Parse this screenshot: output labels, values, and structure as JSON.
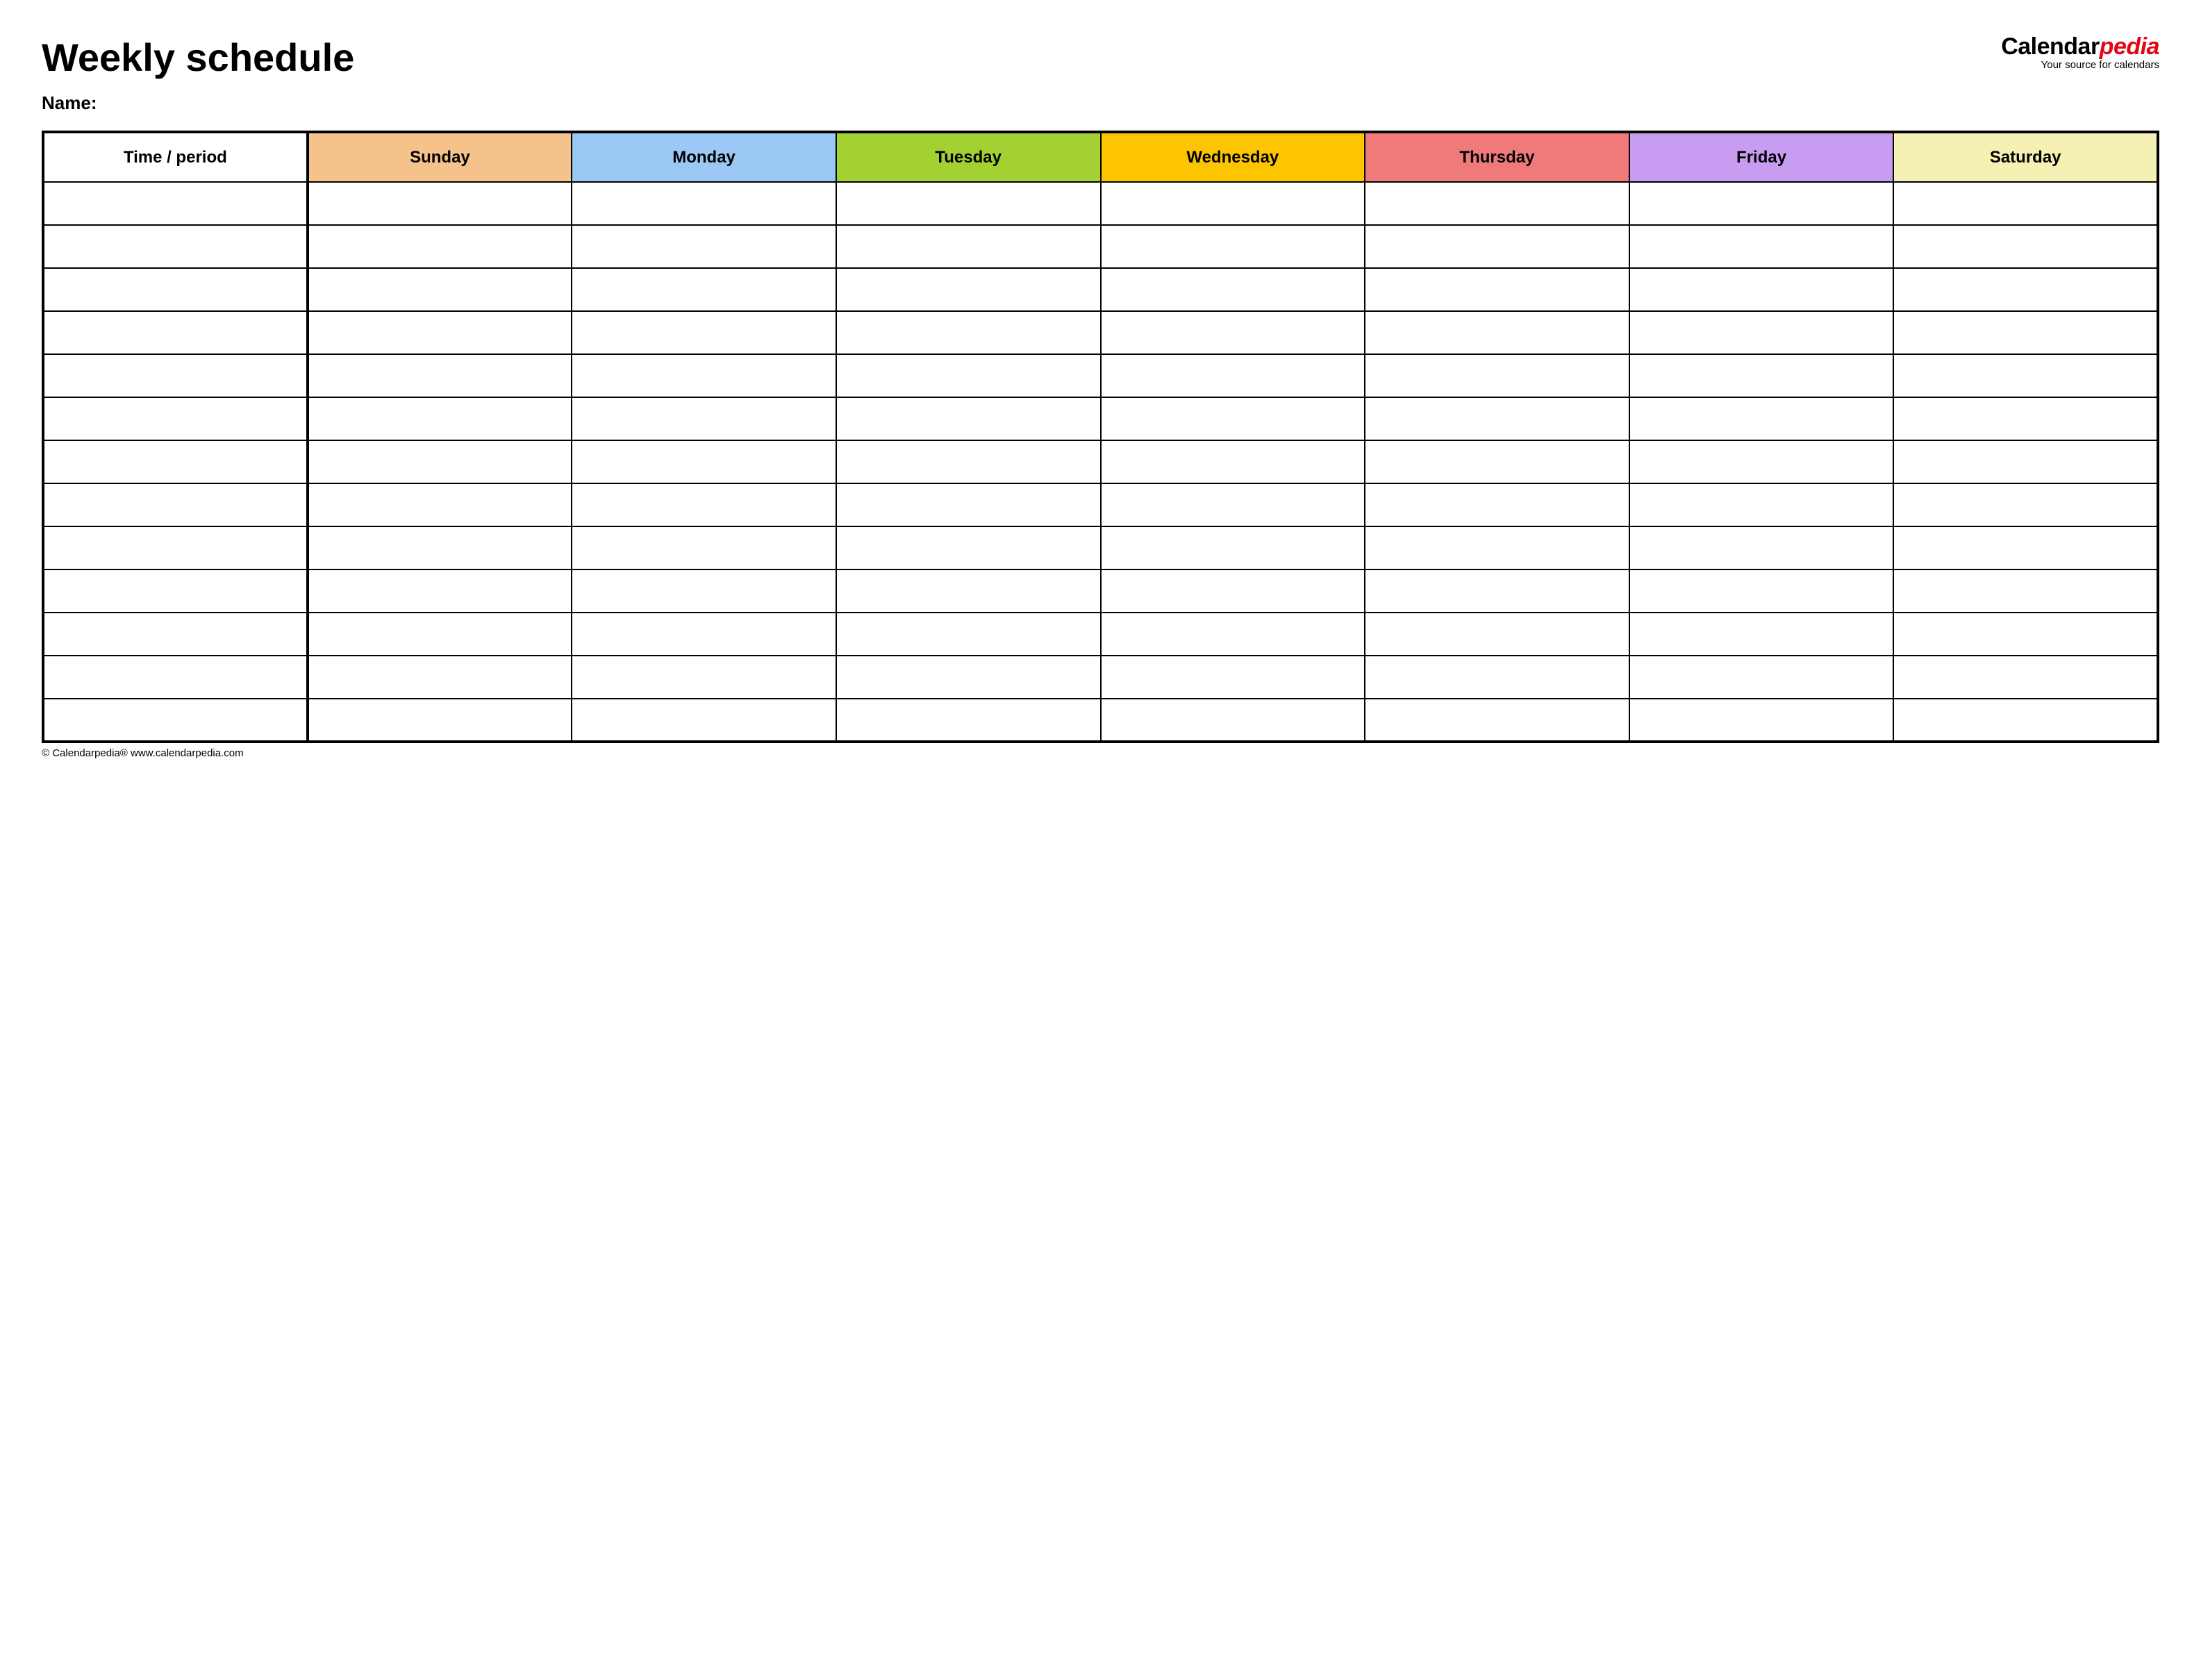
{
  "header": {
    "title": "Weekly schedule",
    "name_label": "Name:"
  },
  "logo": {
    "part1": "Calendar",
    "part2": "pedia",
    "tagline": "Your source for calendars"
  },
  "table": {
    "columns": [
      {
        "label": "Time / period",
        "color": "#ffffff"
      },
      {
        "label": "Sunday",
        "color": "#f6c28b"
      },
      {
        "label": "Monday",
        "color": "#9cc8f5"
      },
      {
        "label": "Tuesday",
        "color": "#a4d132"
      },
      {
        "label": "Wednesday",
        "color": "#fdc400"
      },
      {
        "label": "Thursday",
        "color": "#f07a7a"
      },
      {
        "label": "Friday",
        "color": "#c89cf0"
      },
      {
        "label": "Saturday",
        "color": "#f5f0b3"
      }
    ],
    "row_count": 13
  },
  "footer": {
    "copyright": "© Calendarpedia®   www.calendarpedia.com"
  }
}
